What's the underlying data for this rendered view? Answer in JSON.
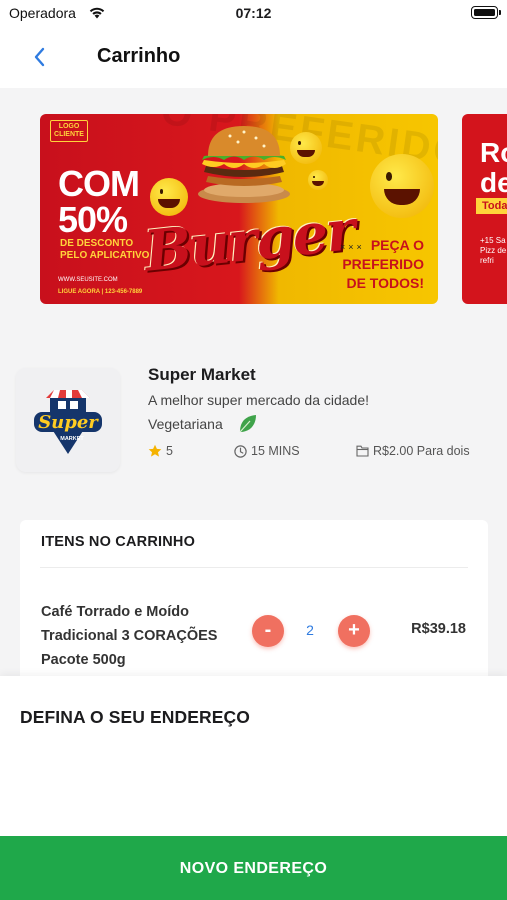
{
  "status_bar": {
    "carrier": "Operadora",
    "time": "07:12"
  },
  "header": {
    "title": "Carrinho"
  },
  "banners": [
    {
      "logo_text": "LOGO CLIENTE",
      "headline": "COM 50%",
      "subtext": "DE DESCONTO PELO APLICATIVO",
      "website": "WWW.SEUSITE.COM",
      "phone_text": "LIGUE AGORA | 123-456-7889",
      "brand": "Burger",
      "tagline": "PEÇA O PREFERIDO DE TODOS!",
      "ghost_text": "O PREFERIDO"
    },
    {
      "headline": "Ro de",
      "badge": "Toda",
      "subtext": "+15 Sa de Pizz de refri"
    }
  ],
  "store": {
    "name": "Super Market",
    "tagline": "A melhor super mercado da cidade!",
    "category": "Vegetariana",
    "rating": "5",
    "delivery_time": "15 MINS",
    "price_for_two": "R$2.00 Para dois",
    "logo_text": "Super",
    "logo_subtext": "MARKET"
  },
  "cart": {
    "heading": "ITENS NO CARRINHO",
    "items": [
      {
        "name": "Café Torrado e Moído Tradicional 3 CORAÇÕES Pacote 500g",
        "quantity": "2",
        "price": "R$39.18",
        "minus_label": "-",
        "plus_label": "+"
      }
    ]
  },
  "address_sheet": {
    "title": "DEFINA O SEU ENDEREÇO",
    "button_label": "NOVO ENDEREÇO"
  },
  "colors": {
    "accent_green": "#1fa84a",
    "qty_button": "#f07060",
    "link_blue": "#2f7be0"
  }
}
